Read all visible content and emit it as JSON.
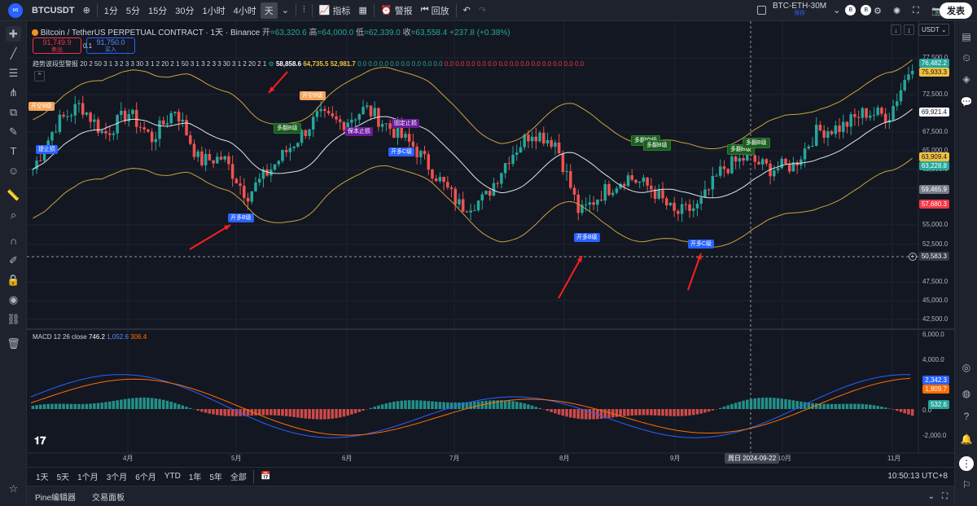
{
  "topbar": {
    "symbol": "BTCUSDT",
    "intervals": [
      "1分",
      "5分",
      "15分",
      "30分",
      "1小时",
      "4小时",
      "天"
    ],
    "active_interval": "天",
    "indicators_label": "指标",
    "alert_label": "警报",
    "replay_label": "回放",
    "pair_name": "BTC-ETH-30M",
    "pair_status": "保存",
    "publish_label": "发表"
  },
  "legend": {
    "title": "Bitcoin / TetherUS PERPETUAL CONTRACT · 1天 · Binance",
    "o_label": "开",
    "o_val": "=63,320.6",
    "h_label": "高",
    "h_val": "=64,000.0",
    "l_label": "低",
    "l_val": "=62,339.0",
    "c_label": "收",
    "c_val": "=63,558.4",
    "change": "+237.8 (+0.38%)",
    "sell_price": "91,749.9",
    "sell_label": "卖出",
    "spread": "0.1",
    "buy_price": "91,750.0",
    "buy_label": "买入",
    "indicator_text": "趋势波段型警报 20 2 50 3 1 3 2 3 3 30 3 1 2 20 2 1 50 3 1 3 2 3 3 30 3 1 2 20 2 1",
    "ind_v1": "58,858.6",
    "ind_v2": "64,735.5",
    "ind_v3": "52,981.7",
    "ind_zeros_green": "0.0 0.0 0.0 0.0 0.0 0.0 0.0 0.0",
    "ind_zeros_red": "0.0 0.0 0.0 0.0 0.0 0.0 0.0 0.0 0.0 0.0 0.0 0.0 0.0",
    "macd_label": "MACD 12 26 close",
    "macd_v1": "746.2",
    "macd_v2": "1,052.6",
    "macd_v3": "306.4"
  },
  "axis": {
    "currency": "USDT",
    "price_ticks": [
      "77,500.0",
      "72,500.0",
      "67,500.0",
      "65,000.0",
      "62,500.0",
      "60,000.0",
      "55,000.0",
      "52,500.0",
      "47,500.0",
      "45,000.0",
      "42,500.0"
    ],
    "macd_ticks": [
      "6,000.0",
      "4,000.0",
      "2,000.0",
      "0.0",
      "-2,000.0"
    ],
    "months": [
      "4月",
      "5月",
      "6月",
      "7月",
      "8月",
      "9月",
      "10月",
      "11月"
    ],
    "crosshair_date": "周日 2024-09-22",
    "crosshair_price": "50,583.3"
  },
  "price_tags": [
    {
      "text": "76,482.2",
      "color": "#26a69a"
    },
    {
      "text": "75,933.3",
      "color": "#f0c040"
    },
    {
      "text": "69,921.4",
      "color": "#ffffff"
    },
    {
      "text": "63,909.4",
      "color": "#f0c040"
    },
    {
      "text": "63,228.8",
      "color": "#26a69a"
    },
    {
      "text": "59,465.9",
      "color": "#787b86"
    },
    {
      "text": "57,680.3",
      "color": "#f23645"
    },
    {
      "text": "2,342.3",
      "color": "#2962ff"
    },
    {
      "text": "1,809.7",
      "color": "#ff6d00"
    },
    {
      "text": "532.6",
      "color": "#26a69a"
    }
  ],
  "signals": {
    "s1": "开空B级",
    "s2": "提止损",
    "s3": "开多B级",
    "s4": "多翻B级",
    "s5": "开空B级",
    "s6": "保本止损",
    "s7": "固定止损",
    "s8": "开多C级",
    "s9": "开多B级",
    "s10": "多翻空级",
    "s11": "多翻B级",
    "s12": "开多C级",
    "s13": "多翻B级",
    "s14": "多翻B级"
  },
  "bottom": {
    "ranges": [
      "1天",
      "5天",
      "1个月",
      "3个月",
      "6个月",
      "YTD",
      "1年",
      "5年",
      "全部"
    ],
    "clock": "10:50:13 UTC+8",
    "tab_pine": "Pine编辑器",
    "tab_trade": "交易面板"
  },
  "chart_data": {
    "type": "candlestick",
    "series": [
      {
        "name": "BTCUSDT",
        "x": [
          "2024-02-28",
          "2024-03-05",
          "2024-03-12",
          "2024-03-19",
          "2024-03-26",
          "2024-04-02",
          "2024-04-09",
          "2024-04-16",
          "2024-04-23",
          "2024-04-30",
          "2024-05-07",
          "2024-05-14",
          "2024-05-21",
          "2024-05-28",
          "2024-06-04",
          "2024-06-11",
          "2024-06-18",
          "2024-06-25",
          "2024-07-02",
          "2024-07-09",
          "2024-07-16",
          "2024-07-23",
          "2024-07-30",
          "2024-08-06",
          "2024-08-13",
          "2024-08-20",
          "2024-08-27",
          "2024-09-03",
          "2024-09-10",
          "2024-09-17",
          "2024-09-24",
          "2024-10-01",
          "2024-10-08",
          "2024-10-15",
          "2024-10-22",
          "2024-10-29",
          "2024-11-05",
          "2024-11-10"
        ],
        "close": [
          62500,
          68500,
          71000,
          67000,
          70000,
          66500,
          70500,
          63500,
          64000,
          59000,
          62500,
          66000,
          69500,
          68500,
          70500,
          68000,
          65500,
          61500,
          57500,
          58500,
          64000,
          67500,
          66000,
          56500,
          59500,
          61500,
          60000,
          56500,
          57500,
          62500,
          64000,
          62500,
          63000,
          67500,
          68000,
          70000,
          69500,
          76500
        ]
      }
    ],
    "ylim": [
      42500,
      77500
    ]
  }
}
